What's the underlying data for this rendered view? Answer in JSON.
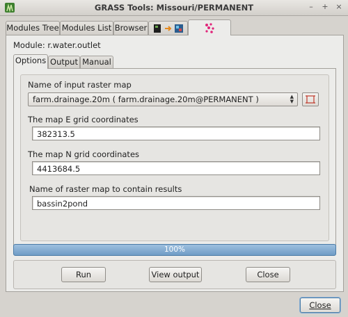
{
  "window": {
    "title": "GRASS Tools: Missouri/PERMANENT",
    "minimize": "–",
    "maximize": "+",
    "close": "×"
  },
  "outer_tabs": [
    {
      "label": "Modules Tree"
    },
    {
      "label": "Modules List"
    },
    {
      "label": "Browser"
    }
  ],
  "module": {
    "label": "Module: r.water.outlet"
  },
  "inner_tabs": [
    {
      "label": "Options"
    },
    {
      "label": "Output"
    },
    {
      "label": "Manual"
    }
  ],
  "options": {
    "input_label": "Name of input raster map",
    "input_value": "farm.drainage.20m ( farm.drainage.20m@PERMANENT )",
    "easting_label": "The map E grid coordinates",
    "easting_value": "382313.5",
    "northing_label": "The map N grid coordinates",
    "northing_value": "4413684.5",
    "output_label": "Name of raster map to contain results",
    "output_value": "bassin2pond"
  },
  "progress": {
    "value": 100,
    "text": "100%"
  },
  "buttons": {
    "run": "Run",
    "view_output": "View output",
    "close": "Close"
  },
  "dialog": {
    "close_label": "Close"
  },
  "colors": {
    "accent": "#6f9cc6",
    "module_icon": "#e0257a"
  }
}
